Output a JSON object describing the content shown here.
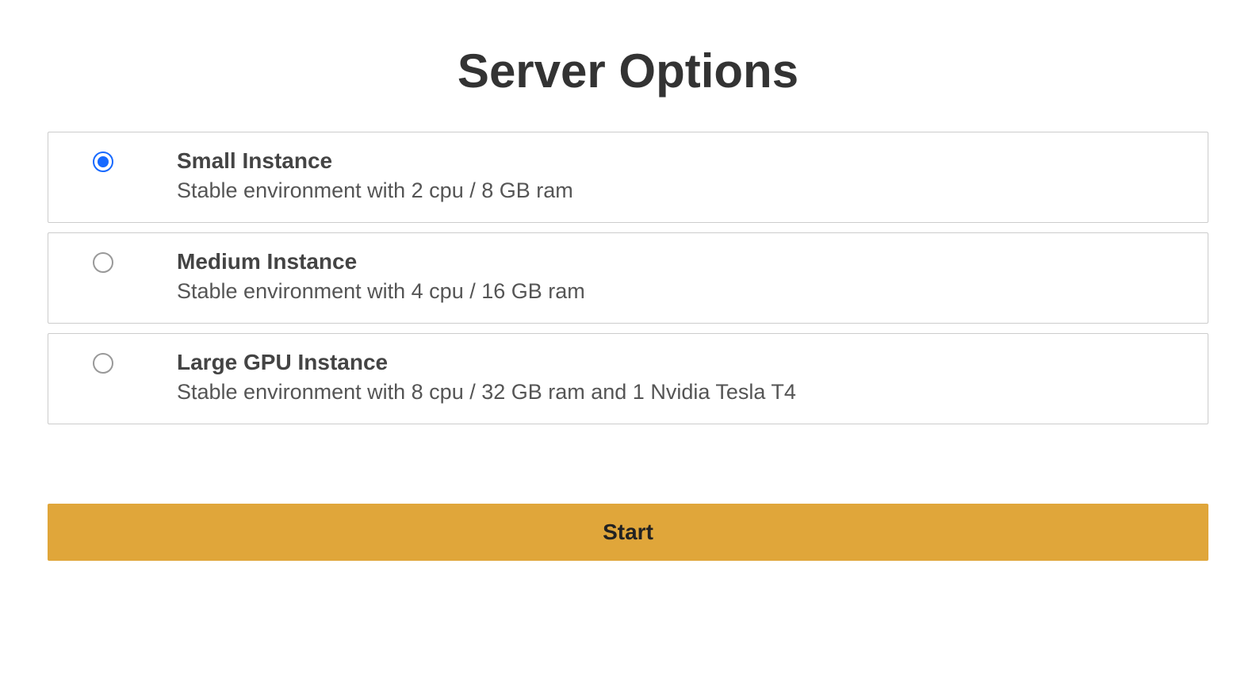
{
  "page": {
    "title": "Server Options",
    "start_label": "Start"
  },
  "options": [
    {
      "title": "Small Instance",
      "description": "Stable environment with 2 cpu / 8 GB ram",
      "selected": true
    },
    {
      "title": "Medium Instance",
      "description": "Stable environment with 4 cpu / 16 GB ram",
      "selected": false
    },
    {
      "title": "Large GPU Instance",
      "description": "Stable environment with 8 cpu / 32 GB ram and 1 Nvidia Tesla T4",
      "selected": false
    }
  ]
}
